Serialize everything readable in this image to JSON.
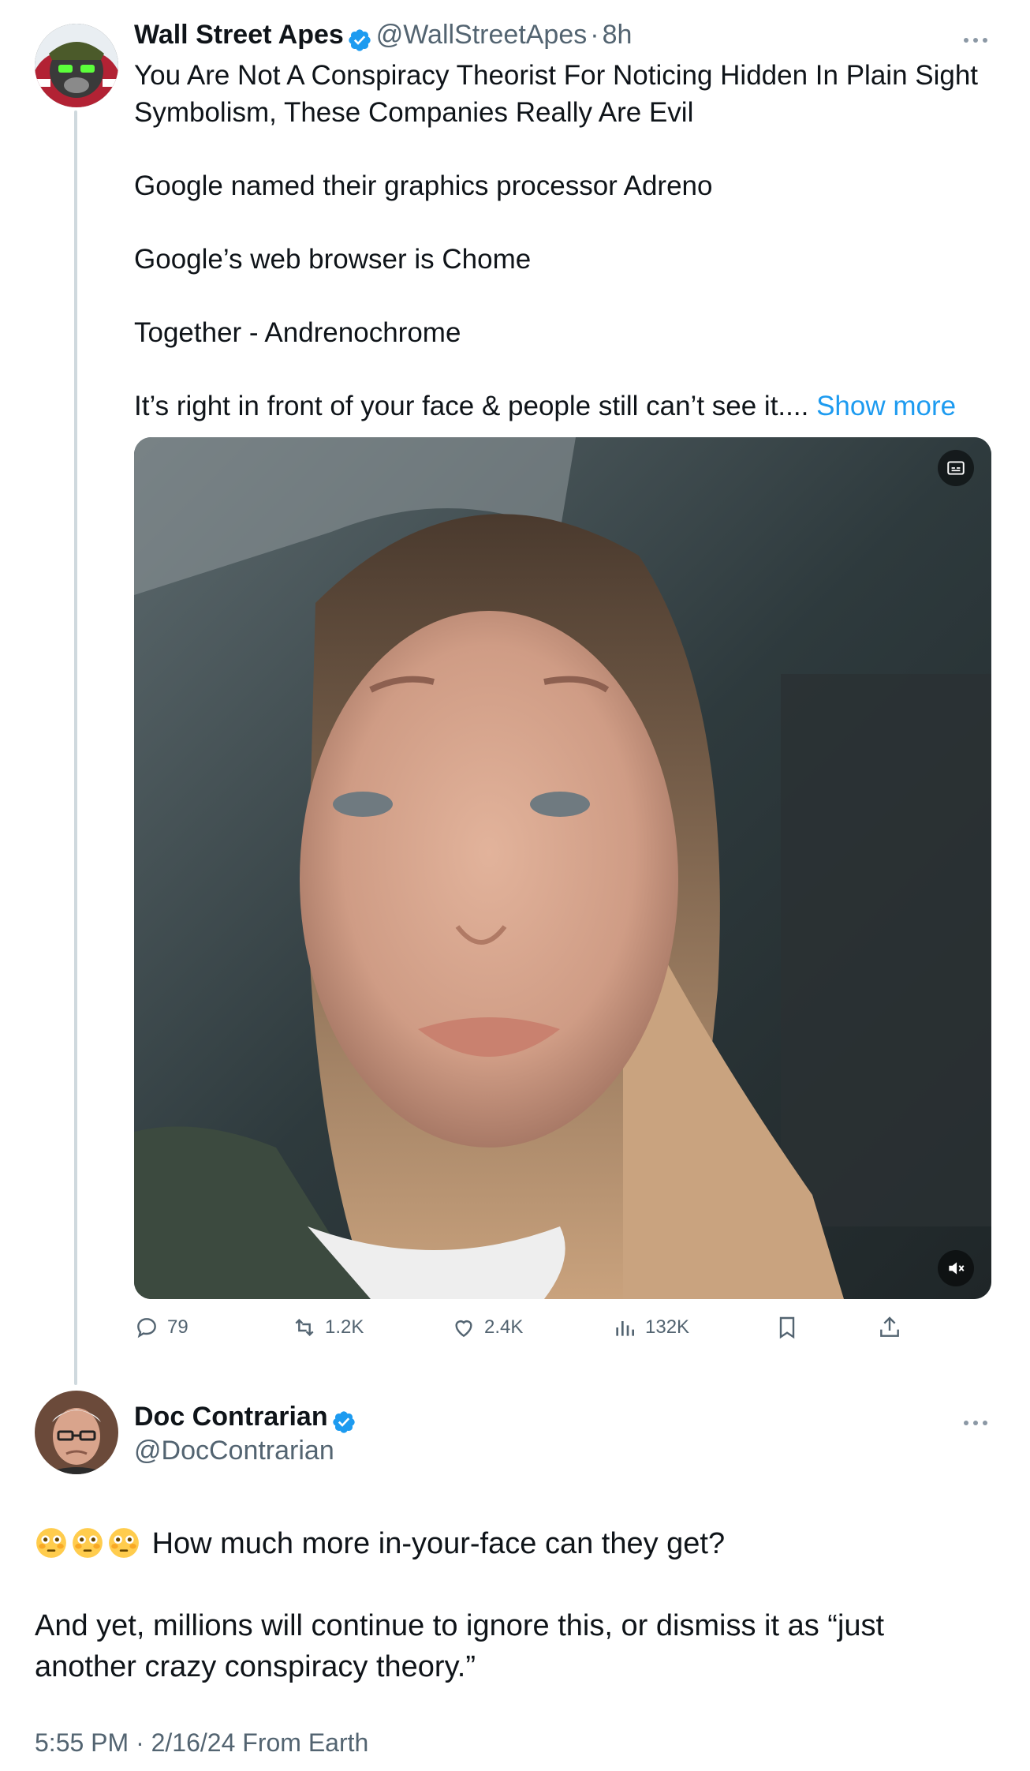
{
  "tweet": {
    "author_name": "Wall Street Apes",
    "author_handle": "@WallStreetApes",
    "separator": "·",
    "time": "8h",
    "text_lines": [
      "You Are Not A Conspiracy Theorist For Noticing Hidden In Plain Sight",
      "Symbolism, These Companies Really Are Evil",
      "Google named their graphics processor Adreno",
      "Google’s web browser is Chome",
      "Together - Andrenochrome",
      "It’s right in front of your face & people still can’t see it...."
    ],
    "show_more": "Show more",
    "more_icon": "ellipsis-icon",
    "stats": {
      "replies": "79",
      "reposts": "1.2K",
      "likes": "2.4K",
      "views": "132K"
    }
  },
  "reply": {
    "author_name": "Doc Contrarian",
    "author_handle": "@DocContrarian",
    "text_line1": "How much more in-your-face can they get?",
    "text_line2a": "And yet, millions will continue to ignore this, or dismiss it as “just",
    "text_line2b": "another crazy conspiracy theory.”",
    "emojis": [
      "flushed-face",
      "flushed-face",
      "flushed-face"
    ],
    "meta": "5:55 PM · 2/16/24 From Earth"
  },
  "colors": {
    "accent": "#1d9bf0",
    "secondary_text": "#536471",
    "thread_line": "#cfd9de"
  }
}
